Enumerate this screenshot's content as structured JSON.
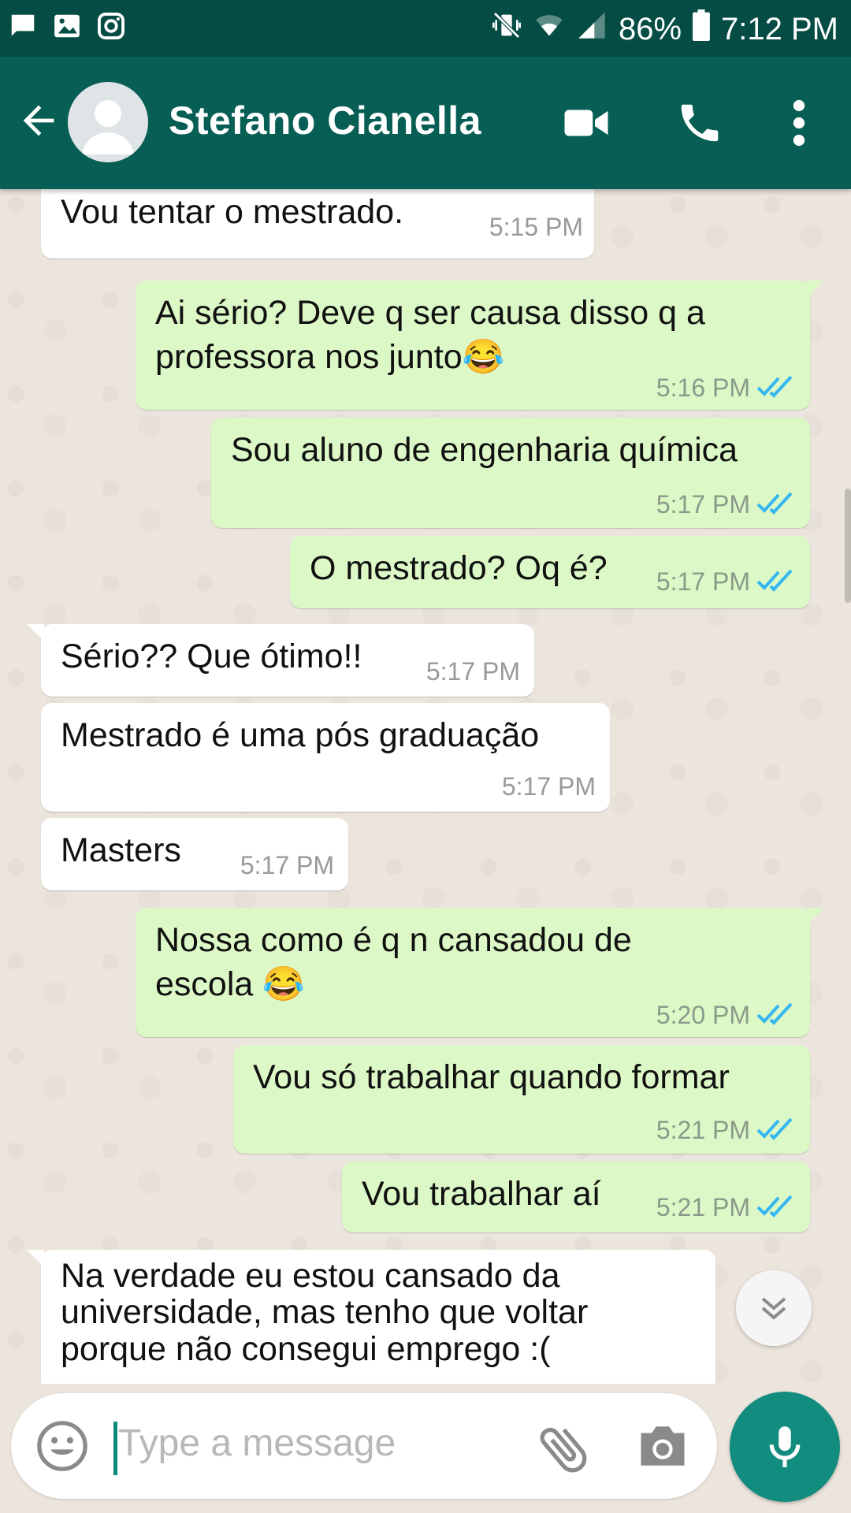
{
  "status": {
    "battery": "86%",
    "time": "7:12 PM"
  },
  "header": {
    "contact_name": "Stefano Cianella"
  },
  "messages": [
    {
      "dir": "in",
      "text": "Vou tentar o mestrado.",
      "time": "5:15 PM"
    },
    {
      "dir": "out",
      "text": "Ai sério? Deve q ser causa disso q a\nprofessora nos junto😂",
      "time": "5:16 PM"
    },
    {
      "dir": "out",
      "text": "Sou aluno de engenharia química",
      "time": "5:17 PM"
    },
    {
      "dir": "out",
      "text": "O mestrado? Oq é?",
      "time": "5:17 PM"
    },
    {
      "dir": "in",
      "text": "Sério?? Que ótimo!!",
      "time": "5:17 PM"
    },
    {
      "dir": "in",
      "text": "Mestrado é uma pós graduação",
      "time": "5:17 PM"
    },
    {
      "dir": "in",
      "text": "Masters",
      "time": "5:17 PM"
    },
    {
      "dir": "out",
      "text": "Nossa como é q n cansadou de\nescola 😂",
      "time": "5:20 PM"
    },
    {
      "dir": "out",
      "text": "Vou só trabalhar quando formar",
      "time": "5:21 PM"
    },
    {
      "dir": "out",
      "text": "Vou trabalhar aí",
      "time": "5:21 PM"
    },
    {
      "dir": "in",
      "text": "Na verdade eu estou cansado da\nuniversidade, mas tenho que voltar\nporque não consegui emprego :(",
      "time": ""
    }
  ],
  "composer": {
    "placeholder": "Type a message"
  },
  "colors": {
    "header": "#075e54",
    "statusbar": "#054d44",
    "outgoing": "#dcf8c6",
    "incoming": "#ffffff",
    "read_ticks": "#34b7f1",
    "mic": "#128c7e"
  }
}
